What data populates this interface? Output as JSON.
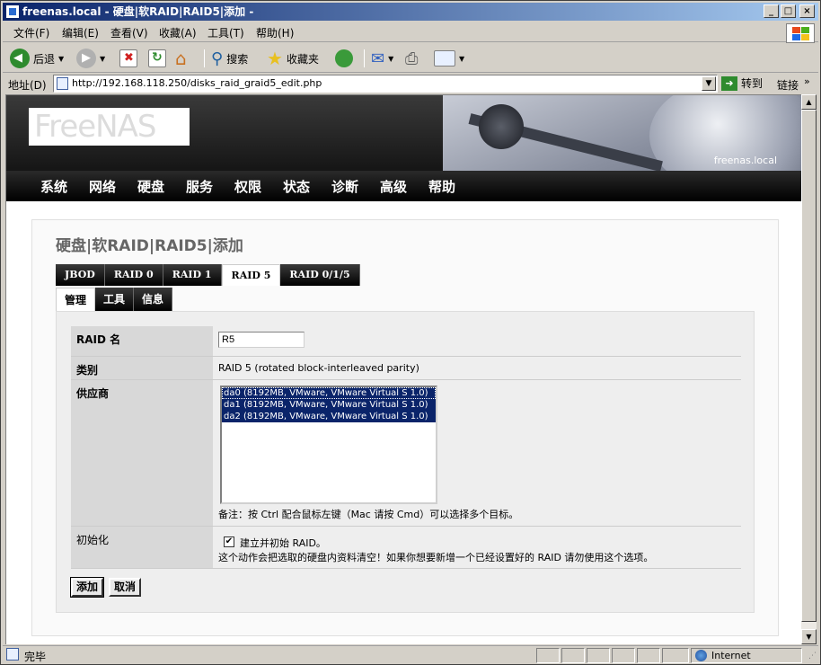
{
  "window": {
    "title": "freenas.local - 硬盘|软RAID|RAID5|添加 -",
    "buttons": {
      "minimize": "_",
      "maximize": "□",
      "close": "×"
    }
  },
  "menu": [
    "文件(F)",
    "编辑(E)",
    "查看(V)",
    "收藏(A)",
    "工具(T)",
    "帮助(H)"
  ],
  "toolbar": {
    "back_label": "后退",
    "search_label": "搜索",
    "favorites_label": "收藏夹"
  },
  "addressbar": {
    "label": "地址(D)",
    "url": "http://192.168.118.250/disks_raid_graid5_edit.php",
    "go_label": "转到",
    "links_label": "链接"
  },
  "header": {
    "logo_text": "FreeNAS",
    "hostname": "freenas.local"
  },
  "nav": [
    "系统",
    "网络",
    "硬盘",
    "服务",
    "权限",
    "状态",
    "诊断",
    "高级",
    "帮助"
  ],
  "page": {
    "title": "硬盘|软RAID|RAID5|添加",
    "tabs": [
      "JBOD",
      "RAID 0",
      "RAID 1",
      "RAID 5",
      "RAID 0/1/5"
    ],
    "active_tab": "RAID 5",
    "subtabs": [
      "管理",
      "工具",
      "信息"
    ],
    "active_subtab": "管理"
  },
  "form": {
    "raid_name": {
      "label": "RAID 名",
      "value": "R5"
    },
    "type": {
      "label": "类别",
      "value": "RAID 5 (rotated block-interleaved parity)"
    },
    "providers": {
      "label": "供应商",
      "options": [
        "da0 (8192MB, VMware, VMware Virtual S 1.0)",
        "da1 (8192MB, VMware, VMware Virtual S 1.0)",
        "da2 (8192MB, VMware, VMware Virtual S 1.0)"
      ],
      "note": "备注：按 Ctrl 配合鼠标左键（Mac 请按 Cmd）可以选择多个目标。"
    },
    "init": {
      "label": "初始化",
      "checkbox_label": "建立并初始 RAID。",
      "checked": true,
      "warning": "这个动作会把选取的硬盘内资料清空！如果你想要新增一个已经设置好的 RAID 请勿使用这个选项。"
    },
    "buttons": {
      "add": "添加",
      "cancel": "取消"
    }
  },
  "status": {
    "text": "完毕",
    "zone": "Internet"
  }
}
